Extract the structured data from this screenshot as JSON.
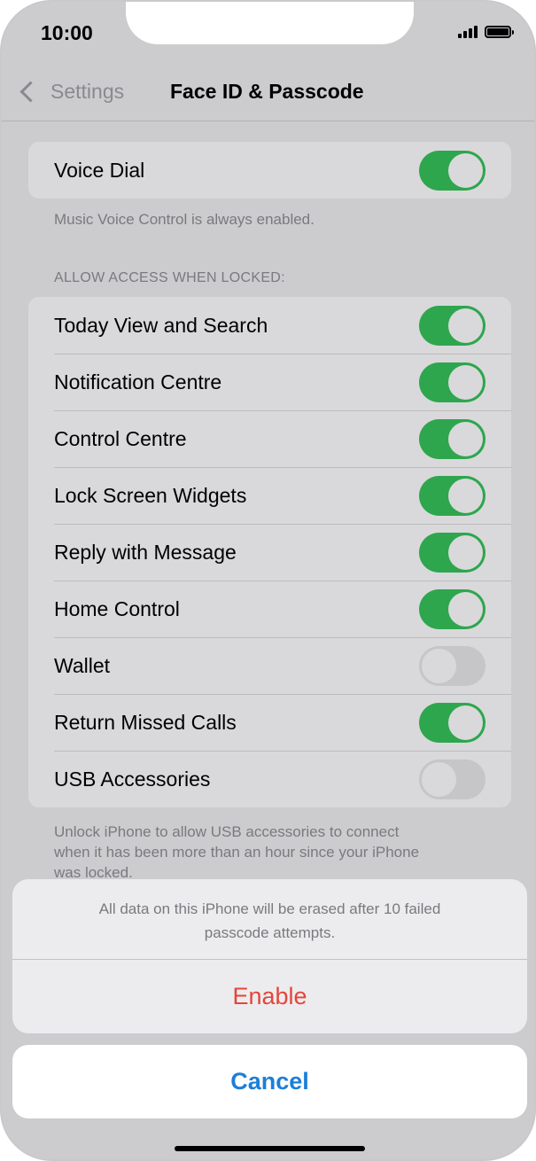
{
  "status": {
    "time": "10:00"
  },
  "nav": {
    "back_label": "Settings",
    "title": "Face ID & Passcode"
  },
  "voice_dial": {
    "label": "Voice Dial",
    "on": true,
    "footer": "Music Voice Control is always enabled."
  },
  "locked_section": {
    "header": "ALLOW ACCESS WHEN LOCKED:",
    "items": [
      {
        "label": "Today View and Search",
        "on": true
      },
      {
        "label": "Notification Centre",
        "on": true
      },
      {
        "label": "Control Centre",
        "on": true
      },
      {
        "label": "Lock Screen Widgets",
        "on": true
      },
      {
        "label": "Reply with Message",
        "on": true
      },
      {
        "label": "Home Control",
        "on": true
      },
      {
        "label": "Wallet",
        "on": false
      },
      {
        "label": "Return Missed Calls",
        "on": true
      },
      {
        "label": "USB Accessories",
        "on": false
      }
    ],
    "footer_lines": [
      "Unlock iPhone to allow USB accessories to connect",
      "when it has been more than an hour since your iPhone",
      "was locked."
    ]
  },
  "action_sheet": {
    "message_lines": [
      "All data on this iPhone will be erased after 10 failed",
      "passcode attempts."
    ],
    "enable_label": "Enable",
    "cancel_label": "Cancel"
  },
  "colors": {
    "toggle_on": "#2ea64d",
    "destructive": "#e5453a",
    "link": "#1b7fd8"
  }
}
